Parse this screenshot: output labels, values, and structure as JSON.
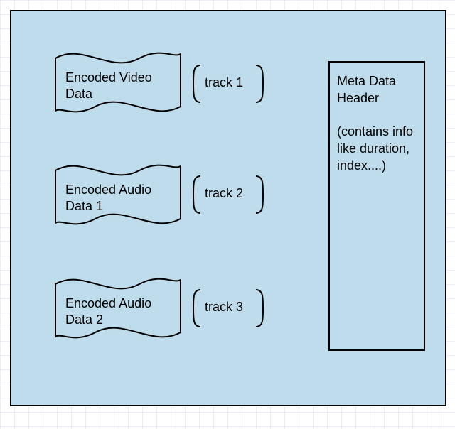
{
  "tracks": [
    {
      "name": "Encoded Video Data",
      "bracket": "track 1"
    },
    {
      "name": "Encoded Audio Data 1",
      "bracket": "track 2"
    },
    {
      "name": "Encoded Audio Data 2",
      "bracket": "track 3"
    }
  ],
  "meta": {
    "title": "Meta Data Header",
    "subtitle": "(contains info like duration, index....)"
  }
}
